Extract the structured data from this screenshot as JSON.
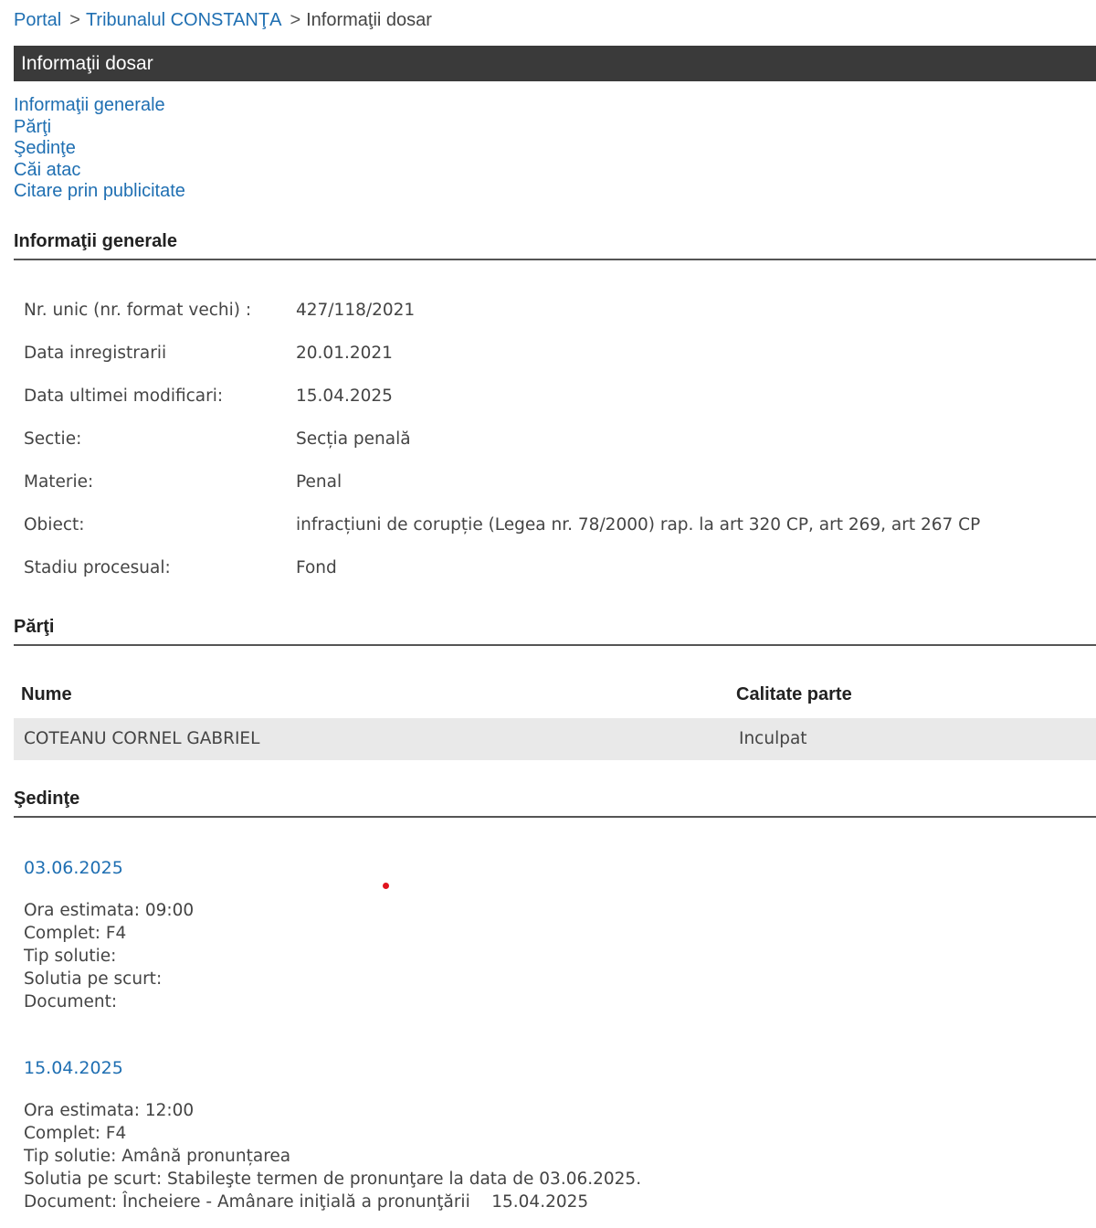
{
  "breadcrumb": {
    "portal": "Portal",
    "sep1": ">",
    "court": "Tribunalul CONSTANŢA",
    "sep2": ">",
    "current": "Informaţii dosar"
  },
  "title_bar": "Informaţii dosar",
  "subnav": [
    "Informaţii generale",
    "Părţi",
    "Şedinţe",
    "Căi atac",
    "Citare prin publicitate"
  ],
  "general": {
    "heading": "Informaţii generale",
    "rows": [
      {
        "label": "Nr. unic (nr. format vechi) :",
        "value": "427/118/2021"
      },
      {
        "label": "Data inregistrarii",
        "value": "20.01.2021"
      },
      {
        "label": "Data ultimei modificari:",
        "value": "15.04.2025"
      },
      {
        "label": "Sectie:",
        "value": "Secția penală"
      },
      {
        "label": "Materie:",
        "value": "Penal"
      },
      {
        "label": "Obiect:",
        "value": "infracțiuni de corupție (Legea nr. 78/2000) rap. la art 320 CP, art 269, art 267 CP"
      },
      {
        "label": "Stadiu procesual:",
        "value": "Fond"
      }
    ]
  },
  "parties": {
    "heading": "Părţi",
    "col_name": "Nume",
    "col_role": "Calitate parte",
    "rows": [
      {
        "name": "COTEANU CORNEL GABRIEL",
        "role": "Inculpat"
      }
    ]
  },
  "hearings": {
    "heading": "Şedinţe",
    "items": [
      {
        "date": "03.06.2025",
        "lines": [
          "Ora estimata: 09:00",
          "Complet: F4",
          "Tip solutie:",
          "Solutia pe scurt:",
          "Document:"
        ]
      },
      {
        "date": "15.04.2025",
        "lines": [
          "Ora estimata: 12:00",
          "Complet: F4",
          "Tip solutie: Amână pronunțarea",
          "Solutia pe scurt: Stabileşte termen de pronunţare la data de 03.06.2025.",
          "Document: Încheiere - Amânare iniţială a pronunţării    15.04.2025"
        ]
      }
    ]
  },
  "colors": {
    "link": "#1f6fb2",
    "title_bar_bg": "#3a3a3a",
    "row_bg": "#e9e9e9",
    "dot": "#e0141e"
  }
}
